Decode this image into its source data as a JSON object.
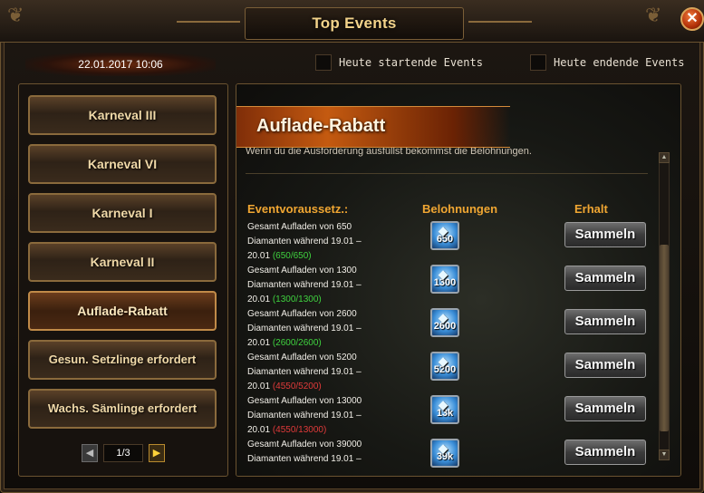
{
  "window": {
    "title": "Top Events",
    "close_icon": "close-icon"
  },
  "date": "22.01.2017 10:06",
  "filters": [
    {
      "label": "Heute startende Events",
      "checked": false
    },
    {
      "label": "Heute endende Events",
      "checked": false
    }
  ],
  "events": [
    {
      "label": "Karneval III",
      "active": false
    },
    {
      "label": "Karneval VI",
      "active": false
    },
    {
      "label": "Karneval I",
      "active": false
    },
    {
      "label": "Karneval II",
      "active": false
    },
    {
      "label": "Auflade-Rabatt",
      "active": true
    },
    {
      "label": "Gesun. Setzlinge erfordert",
      "active": false
    },
    {
      "label": "Wachs. Sämlinge erfordert",
      "active": false
    }
  ],
  "pager": {
    "prev": "◀",
    "page": "1/3",
    "next": "▶"
  },
  "detail": {
    "title": "Auflade-Rabatt",
    "description": "Wenn du die Ausforderung ausfüllst bekommst die Belohnungen.",
    "headers": {
      "condition": "Eventvoraussetz.:",
      "reward": "Belohnungen",
      "claim": "Erhalt"
    },
    "rows": [
      {
        "line1": "Gesamt Aufladen von 650",
        "line2": "Diamanten während 19.01 –",
        "line3": "20.01",
        "progress": "(650/650)",
        "complete": true,
        "reward": "650",
        "button": "Sammeln"
      },
      {
        "line1": "Gesamt Aufladen von 1300",
        "line2": "Diamanten während 19.01 –",
        "line3": "20.01",
        "progress": "(1300/1300)",
        "complete": true,
        "reward": "1300",
        "button": "Sammeln"
      },
      {
        "line1": "Gesamt Aufladen von 2600",
        "line2": "Diamanten während 19.01 –",
        "line3": "20.01",
        "progress": "(2600/2600)",
        "complete": true,
        "reward": "2600",
        "button": "Sammeln"
      },
      {
        "line1": "Gesamt Aufladen von 5200",
        "line2": "Diamanten während 19.01 –",
        "line3": "20.01",
        "progress": "(4550/5200)",
        "complete": false,
        "reward": "5200",
        "button": "Sammeln"
      },
      {
        "line1": "Gesamt Aufladen von 13000",
        "line2": "Diamanten während 19.01 –",
        "line3": "20.01",
        "progress": "(4550/13000)",
        "complete": false,
        "reward": "13k",
        "button": "Sammeln"
      },
      {
        "line1": "Gesamt Aufladen von 39000",
        "line2": "Diamanten während 19.01 –",
        "line3": "",
        "progress": "",
        "complete": false,
        "reward": "39k",
        "button": "Sammeln"
      }
    ]
  },
  "colors": {
    "accent": "#f0a632",
    "progress_ok": "#3fd23f",
    "progress_bad": "#e03a3a",
    "title": "#f3d38a"
  }
}
